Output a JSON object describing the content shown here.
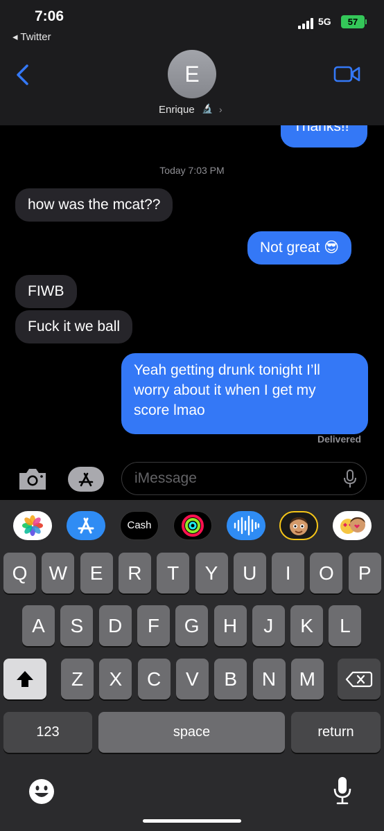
{
  "status_bar": {
    "time": "7:06",
    "back_app": "◂ Twitter",
    "network": "5G",
    "battery": "57"
  },
  "contact": {
    "initial": "E",
    "name": "Enrique",
    "emoji": "🔬",
    "chevron": "›"
  },
  "messages": {
    "partial_sent": "Thanks!!",
    "timestamp": "Today 7:03 PM",
    "m1": "how was the mcat??",
    "m2": "Not great 😎",
    "m3": "FIWB",
    "m4": "Fuck it we ball",
    "m5_line1": "Yeah getting drunk tonight I’ll",
    "m5_line2": "worry about it when I get my",
    "m5_line3": "score lmao",
    "status": "Delivered"
  },
  "compose": {
    "placeholder": "iMessage"
  },
  "app_strip": [
    "photos-app",
    "app-store-app",
    "cash-app",
    "activity-app",
    "audio-message-app",
    "memoji-app",
    "memoji-stickers-app"
  ],
  "app_strip_labels": {
    "cash": "Cash"
  },
  "keyboard": {
    "row1": [
      "Q",
      "W",
      "E",
      "R",
      "T",
      "Y",
      "U",
      "I",
      "O",
      "P"
    ],
    "row2": [
      "A",
      "S",
      "D",
      "F",
      "G",
      "H",
      "J",
      "K",
      "L"
    ],
    "row3": [
      "Z",
      "X",
      "C",
      "V",
      "B",
      "N",
      "M"
    ],
    "numbers": "123",
    "space": "space",
    "return": "return"
  },
  "colors": {
    "sent": "#3478f6",
    "received": "#26252a",
    "accent": "#3478f6"
  }
}
